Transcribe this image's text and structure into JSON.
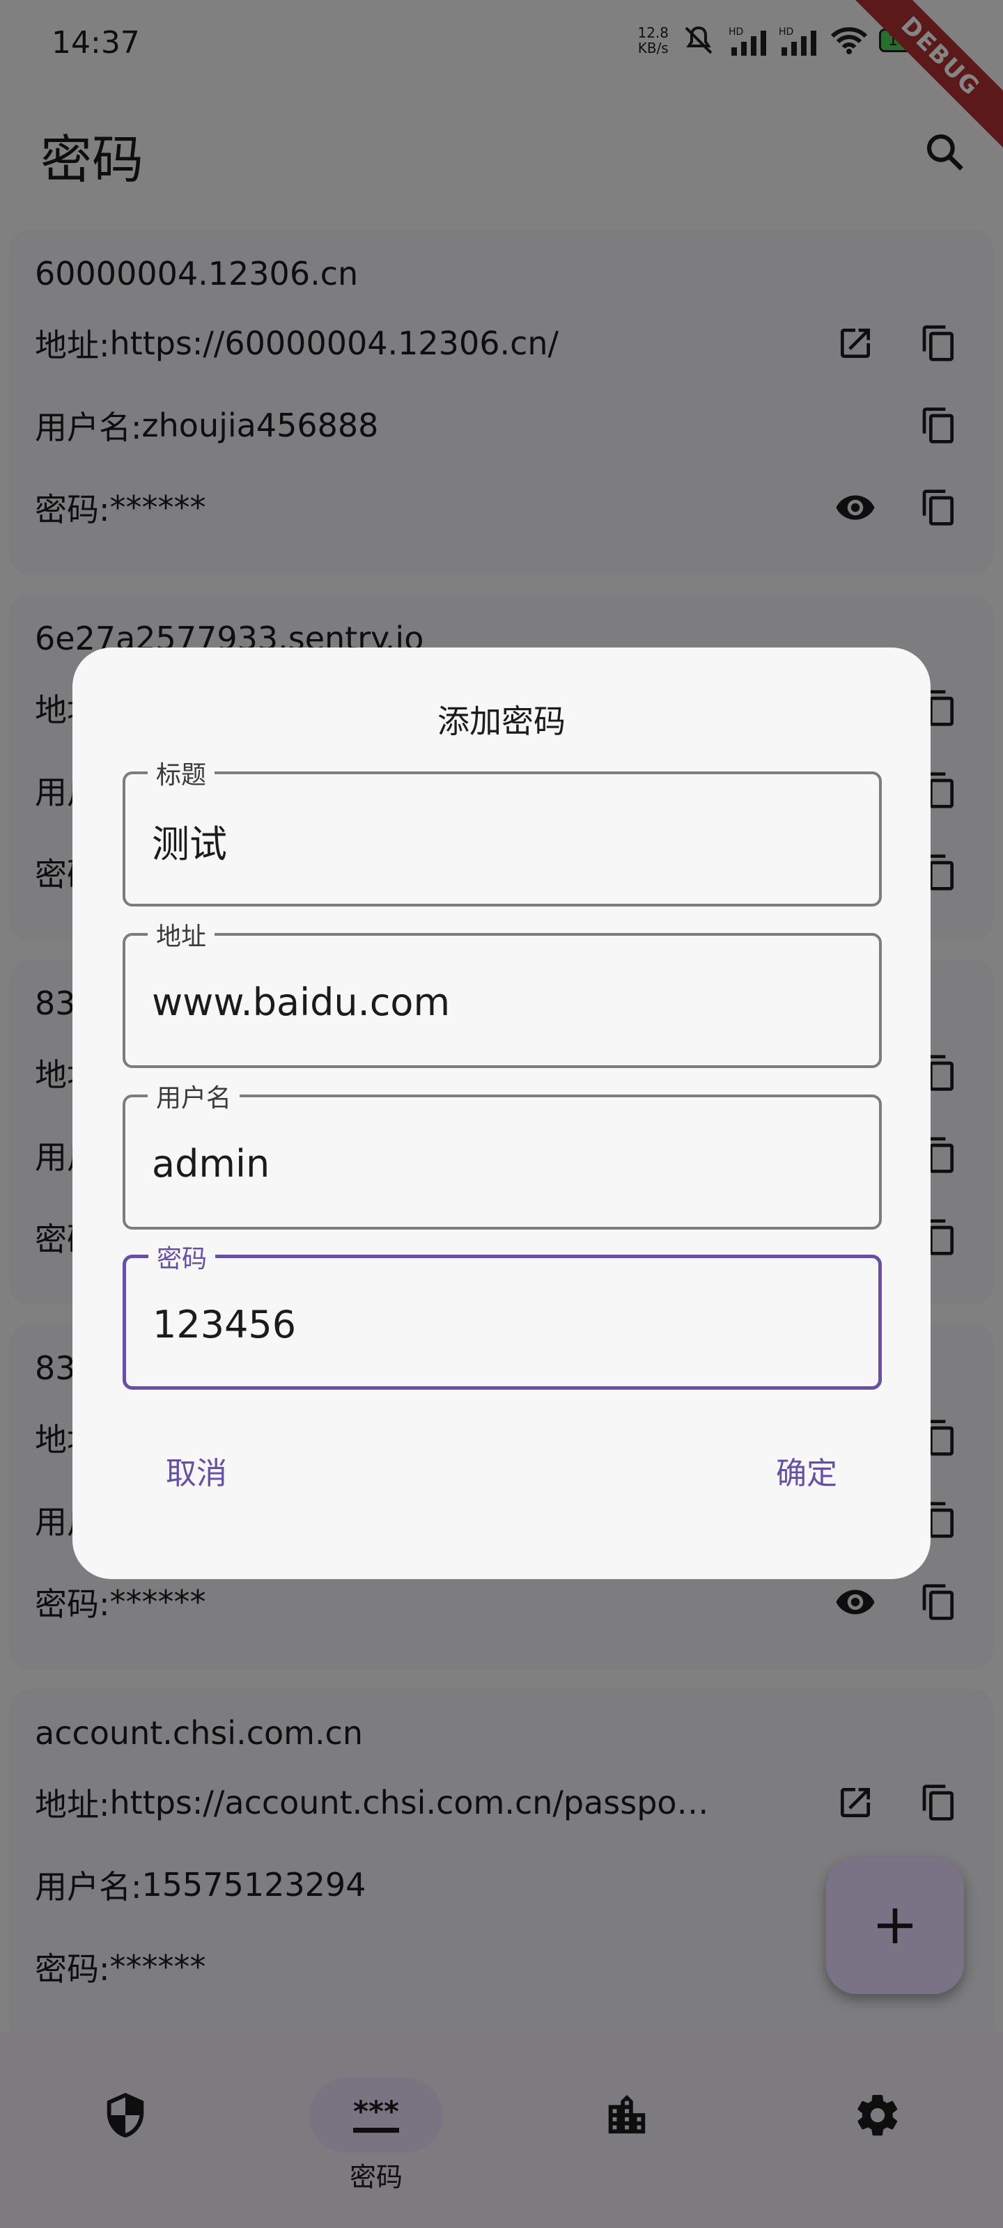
{
  "status_bar": {
    "time": "14:37",
    "net_speed_value": "12.8",
    "net_speed_unit": "KB/s",
    "signal_label_1": "HD",
    "signal_label_2": "HD",
    "battery": "100",
    "debug_banner": "DEBUG"
  },
  "appbar": {
    "title": "密码",
    "search_icon": "search-icon"
  },
  "labels": {
    "address": "地址:",
    "username": "用户名:",
    "password": "密码:"
  },
  "cards": [
    {
      "title": "60000004.12306.cn",
      "address": "https://60000004.12306.cn/",
      "username": "zhoujia456888",
      "password": "******"
    },
    {
      "title": "6e27a2577933.sentry.io",
      "address": "",
      "username": "",
      "password": "******"
    },
    {
      "title": "83",
      "address": "",
      "username": "",
      "password": "******"
    },
    {
      "title": "83",
      "address": "",
      "username": "",
      "password": "******"
    },
    {
      "title": "account.chsi.com.cn",
      "address": "https://account.chsi.com.cn/passpo…",
      "username": "15575123294",
      "password": "******"
    }
  ],
  "fab": {
    "icon": "plus-icon"
  },
  "nav": {
    "items": [
      {
        "icon": "shield-icon",
        "label": ""
      },
      {
        "icon": "password-icon",
        "label": "密码"
      },
      {
        "icon": "building-icon",
        "label": ""
      },
      {
        "icon": "gear-icon",
        "label": ""
      }
    ],
    "active_index": 1
  },
  "dialog": {
    "title": "添加密码",
    "fields": [
      {
        "label": "标题",
        "value": "测试"
      },
      {
        "label": "地址",
        "value": "www.baidu.com"
      },
      {
        "label": "用户名",
        "value": "admin"
      },
      {
        "label": "密码",
        "value": "123456"
      }
    ],
    "cancel_label": "取消",
    "confirm_label": "确定"
  },
  "colors": {
    "accent": "#6750a4",
    "scrim": "#00000080",
    "active_pill": "#e8def8"
  }
}
